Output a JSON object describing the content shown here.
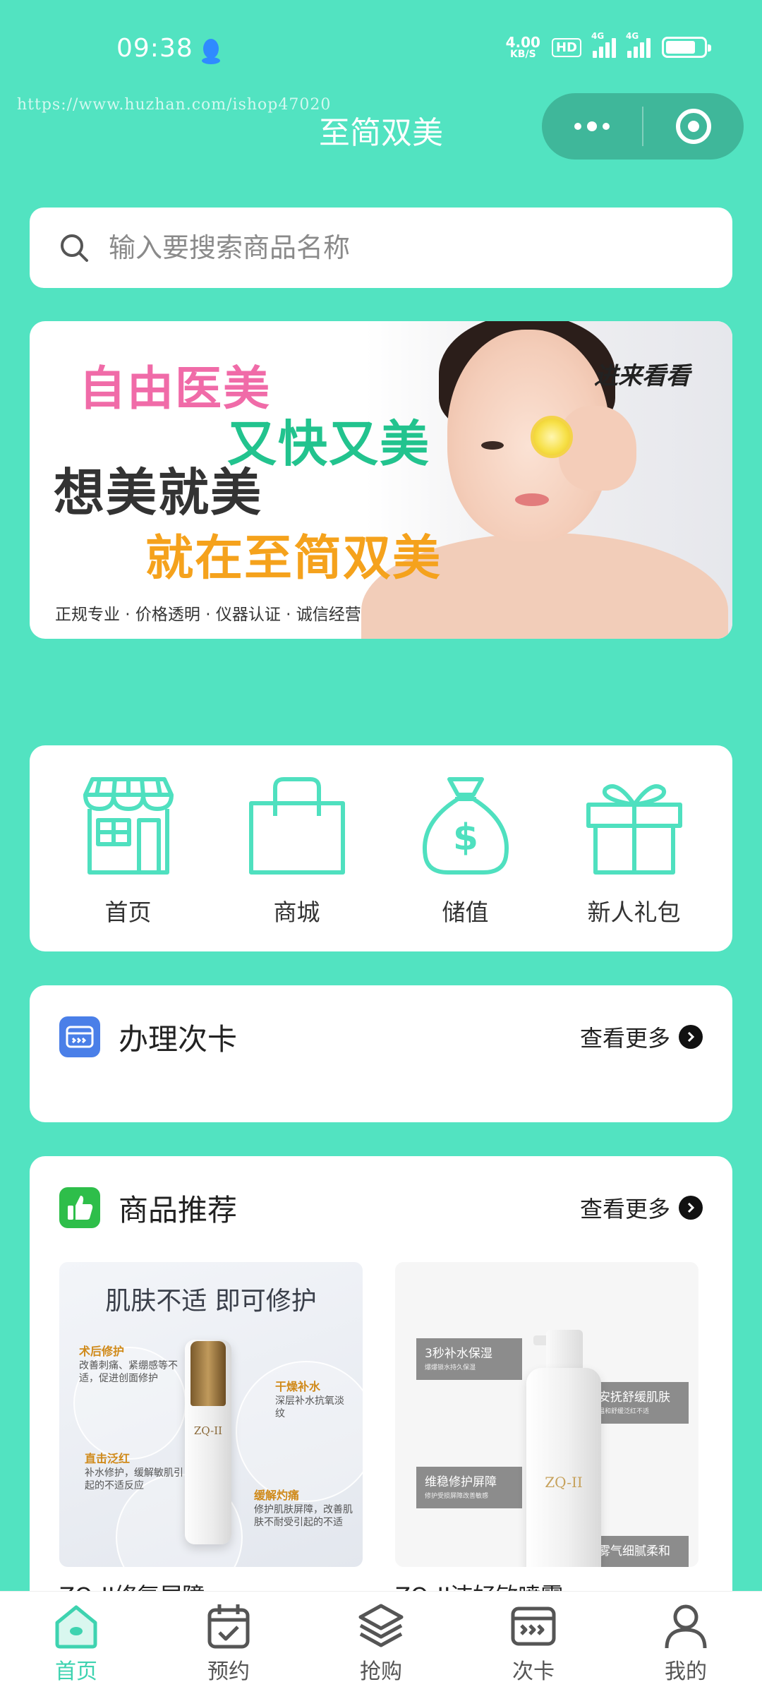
{
  "status_bar": {
    "time": "09:38",
    "net_speed_value": "4.00",
    "net_speed_unit": "KB/S",
    "hd_badge": "HD",
    "sim1_label": "4G",
    "sim2_label": "4G"
  },
  "watermark": "https://www.huzhan.com/ishop47020",
  "nav": {
    "title": "至简双美"
  },
  "search": {
    "placeholder": "输入要搜索商品名称"
  },
  "banner": {
    "line1": "自由医美",
    "line2": "又快又美",
    "line3": "想美就美",
    "line4": "就在至简双美",
    "tags": "正规专业 · 价格透明 · 仪器认证 · 诚信经营",
    "cta": "进来看看"
  },
  "quick_menu": [
    {
      "label": "首页",
      "icon": "store-icon"
    },
    {
      "label": "商城",
      "icon": "shopping-bag-icon"
    },
    {
      "label": "储值",
      "icon": "money-bag-icon"
    },
    {
      "label": "新人礼包",
      "icon": "gift-icon"
    }
  ],
  "card_section": {
    "title": "办理次卡",
    "more": "查看更多"
  },
  "recommend_section": {
    "title": "商品推荐",
    "more": "查看更多",
    "products": [
      {
        "name": "ZQ-II修复屏障",
        "headline": "肌肤不适 即可修护",
        "brand": "ZQ-II",
        "notes": [
          {
            "title": "术后修护",
            "text": "改善刺痛、紧绷感等不适，促进创面修护"
          },
          {
            "title": "干燥补水",
            "text": "深层补水抗氧淡纹"
          },
          {
            "title": "直击泛红",
            "text": "补水修护，缓解敏肌引起的不适反应"
          },
          {
            "title": "缓解灼痛",
            "text": "修护肌肤屏障，改善肌肤不耐受引起的不适"
          }
        ]
      },
      {
        "name": "ZQ-II洁好敏喷雾",
        "brand": "ZQ-II",
        "boxes": [
          {
            "title": "3秒补水保湿",
            "text": "爆爆锁水持久保湿"
          },
          {
            "title": "安抚舒缓肌肤",
            "text": "温和舒缓泛红不适"
          },
          {
            "title": "维稳修护屏障",
            "text": "修护受损屏障改善敏感"
          },
          {
            "title": "雾气细腻柔和",
            "text": ""
          }
        ]
      }
    ]
  },
  "tabbar": [
    {
      "label": "首页",
      "icon": "home-icon",
      "active": true
    },
    {
      "label": "预约",
      "icon": "calendar-check-icon",
      "active": false
    },
    {
      "label": "抢购",
      "icon": "layers-icon",
      "active": false
    },
    {
      "label": "次卡",
      "icon": "card-icon",
      "active": false
    },
    {
      "label": "我的",
      "icon": "user-icon",
      "active": false
    }
  ],
  "colors": {
    "background": "#52E3C1",
    "accent": "#3ED3B0",
    "capsule": "#3FB79A"
  }
}
